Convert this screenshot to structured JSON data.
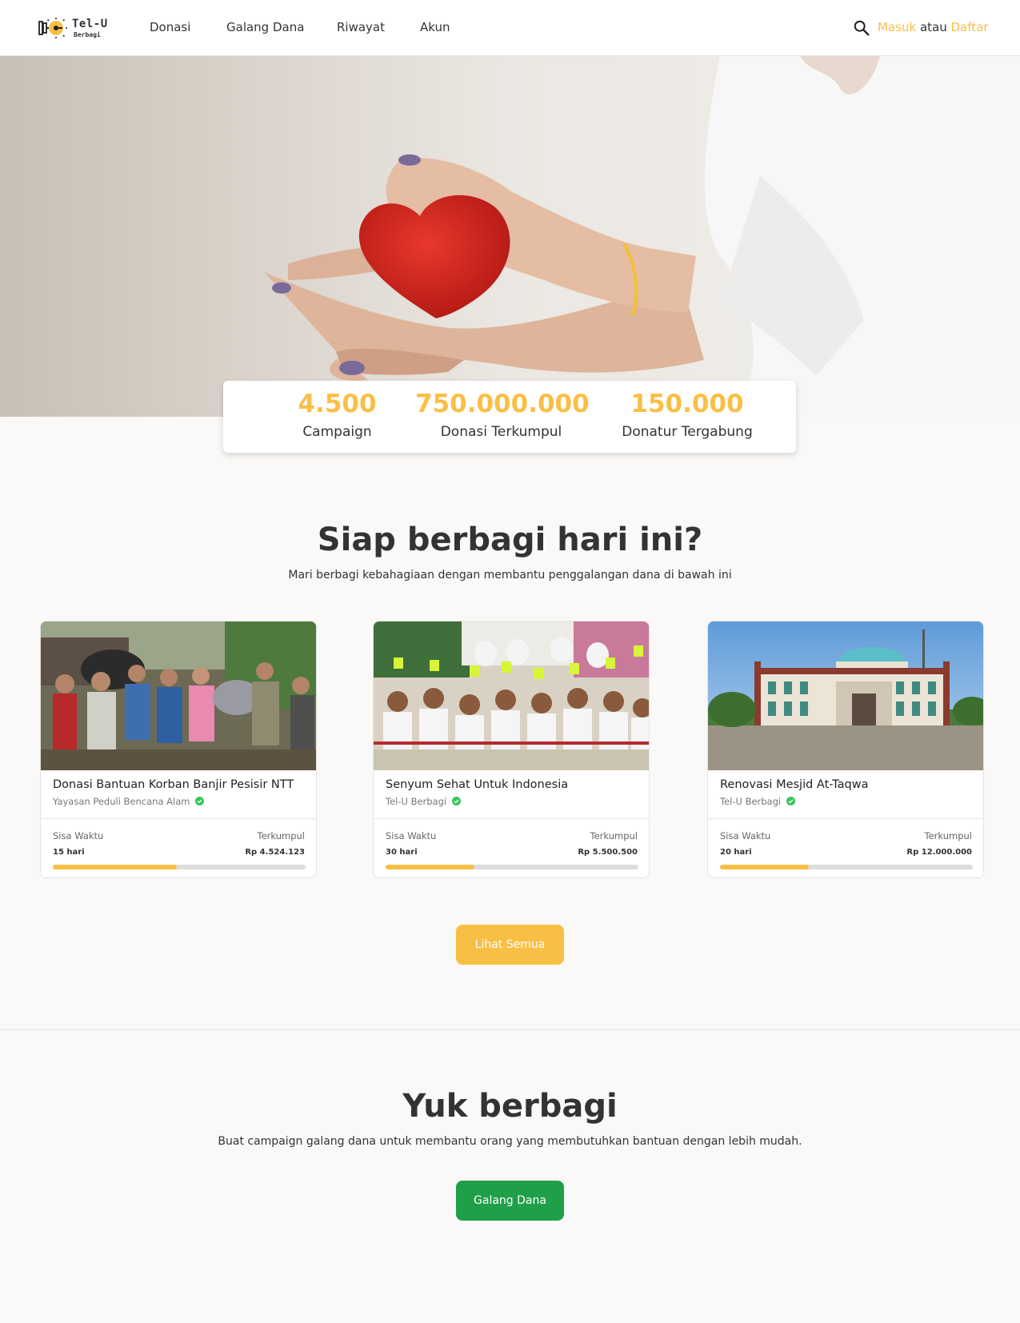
{
  "header": {
    "logo_title": "Tel-U",
    "logo_sub": "Berbagi",
    "nav": [
      "Donasi",
      "Galang Dana",
      "Riwayat",
      "Akun"
    ],
    "login": "Masuk",
    "or": "atau",
    "register": "Daftar"
  },
  "stats": [
    {
      "value": "4.500",
      "label": "Campaign"
    },
    {
      "value": "750.000.000",
      "label": "Donasi Terkumpul"
    },
    {
      "value": "150.000",
      "label": "Donatur Tergabung"
    }
  ],
  "section1": {
    "title": "Siap berbagi hari ini?",
    "subtitle": "Mari berbagi kebahagiaan dengan membantu penggalangan dana di bawah ini",
    "button": "Lihat Semua"
  },
  "campaigns": [
    {
      "title": "Donasi Bantuan Korban Banjir Pesisir NTT",
      "org": "Yayasan Peduli Bencana Alam",
      "time_label": "Sisa Waktu",
      "time": "15 hari",
      "collected_label": "Terkumpul",
      "collected": "Rp 4.524.123",
      "progress": 0.49
    },
    {
      "title": "Senyum Sehat Untuk Indonesia",
      "org": "Tel-U Berbagi",
      "time_label": "Sisa Waktu",
      "time": "30 hari",
      "collected_label": "Terkumpul",
      "collected": "Rp 5.500.500",
      "progress": 0.35
    },
    {
      "title": "Renovasi Mesjid At-Taqwa",
      "org": "Tel-U Berbagi",
      "time_label": "Sisa Waktu",
      "time": "20 hari",
      "collected_label": "Terkumpul",
      "collected": "Rp 12.000.000",
      "progress": 0.35
    }
  ],
  "section2": {
    "title": "Yuk berbagi",
    "subtitle": "Buat campaign galang dana untuk membantu orang yang membutuhkan bantuan dengan lebih mudah.",
    "button": "Galang Dana"
  },
  "colors": {
    "accent": "#f9bf45",
    "green": "#1e9f48",
    "background": "#faf9f7"
  }
}
